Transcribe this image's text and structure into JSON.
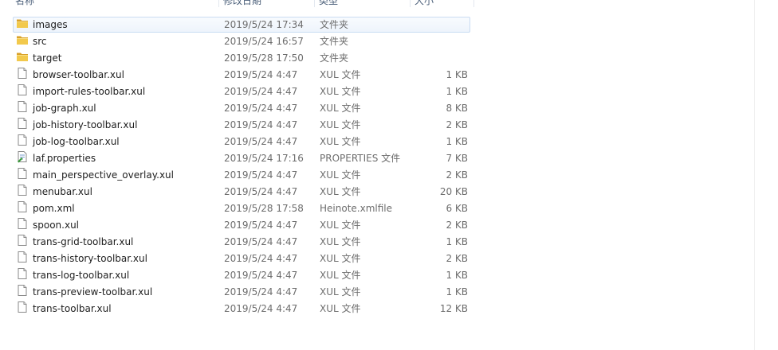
{
  "columns": {
    "name": "名称",
    "date": "修改日期",
    "type": "类型",
    "size": "大小"
  },
  "files": [
    {
      "name": "images",
      "date": "2019/5/24 17:34",
      "type": "文件夹",
      "size": "",
      "icon": "folder",
      "selected": true
    },
    {
      "name": "src",
      "date": "2019/5/24 16:57",
      "type": "文件夹",
      "size": "",
      "icon": "folder"
    },
    {
      "name": "target",
      "date": "2019/5/28 17:50",
      "type": "文件夹",
      "size": "",
      "icon": "folder"
    },
    {
      "name": "browser-toolbar.xul",
      "date": "2019/5/24 4:47",
      "type": "XUL 文件",
      "size": "1 KB",
      "icon": "file"
    },
    {
      "name": "import-rules-toolbar.xul",
      "date": "2019/5/24 4:47",
      "type": "XUL 文件",
      "size": "1 KB",
      "icon": "file"
    },
    {
      "name": "job-graph.xul",
      "date": "2019/5/24 4:47",
      "type": "XUL 文件",
      "size": "8 KB",
      "icon": "file"
    },
    {
      "name": "job-history-toolbar.xul",
      "date": "2019/5/24 4:47",
      "type": "XUL 文件",
      "size": "2 KB",
      "icon": "file"
    },
    {
      "name": "job-log-toolbar.xul",
      "date": "2019/5/24 4:47",
      "type": "XUL 文件",
      "size": "1 KB",
      "icon": "file"
    },
    {
      "name": "laf.properties",
      "date": "2019/5/24 17:16",
      "type": "PROPERTIES 文件",
      "size": "7 KB",
      "icon": "properties"
    },
    {
      "name": "main_perspective_overlay.xul",
      "date": "2019/5/24 4:47",
      "type": "XUL 文件",
      "size": "2 KB",
      "icon": "file"
    },
    {
      "name": "menubar.xul",
      "date": "2019/5/24 4:47",
      "type": "XUL 文件",
      "size": "20 KB",
      "icon": "file"
    },
    {
      "name": "pom.xml",
      "date": "2019/5/28 17:58",
      "type": "Heinote.xmlfile",
      "size": "6 KB",
      "icon": "file"
    },
    {
      "name": "spoon.xul",
      "date": "2019/5/24 4:47",
      "type": "XUL 文件",
      "size": "2 KB",
      "icon": "file"
    },
    {
      "name": "trans-grid-toolbar.xul",
      "date": "2019/5/24 4:47",
      "type": "XUL 文件",
      "size": "1 KB",
      "icon": "file"
    },
    {
      "name": "trans-history-toolbar.xul",
      "date": "2019/5/24 4:47",
      "type": "XUL 文件",
      "size": "2 KB",
      "icon": "file"
    },
    {
      "name": "trans-log-toolbar.xul",
      "date": "2019/5/24 4:47",
      "type": "XUL 文件",
      "size": "1 KB",
      "icon": "file"
    },
    {
      "name": "trans-preview-toolbar.xul",
      "date": "2019/5/24 4:47",
      "type": "XUL 文件",
      "size": "1 KB",
      "icon": "file"
    },
    {
      "name": "trans-toolbar.xul",
      "date": "2019/5/24 4:47",
      "type": "XUL 文件",
      "size": "12 KB",
      "icon": "file"
    }
  ],
  "colors": {
    "selection_border": "#c9dcf2",
    "selection_fill": "#eef4fc",
    "folder": "#e8b73a",
    "header_text": "#4c607a",
    "secondary_text": "#6d6d6d"
  }
}
